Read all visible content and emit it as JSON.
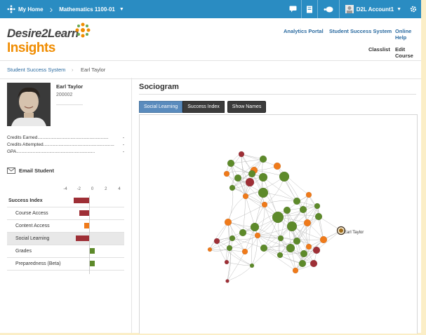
{
  "topbar": {
    "home_label": "My Home",
    "course_label": "Mathematics 1100-01",
    "account_label": "D2L Account1"
  },
  "header": {
    "logo_line1": "Desire2Learn",
    "logo_line2": "Insights",
    "links": [
      "Analytics Portal",
      "Student Success System",
      "Online Help"
    ],
    "sublinks": [
      "Classlist",
      "Edit Course"
    ]
  },
  "breadcrumb": {
    "root": "Student Success System",
    "current": "Earl Taylor"
  },
  "student": {
    "name": "Earl Taylor",
    "id": "200002",
    "stats": [
      {
        "label": "Credits Earned",
        "value": "-"
      },
      {
        "label": "Credits Attempted",
        "value": "-"
      },
      {
        "label": "GPA",
        "value": "-"
      }
    ],
    "email_label": "Email Student"
  },
  "success_index": {
    "axis_ticks": [
      "-4",
      "-2",
      "0",
      "2",
      "4"
    ],
    "axis_min": -4,
    "axis_max": 4,
    "rows": [
      {
        "label": "Success Index",
        "value": -2.3,
        "color": "#9e2f36",
        "bold": true
      },
      {
        "label": "Course Access",
        "value": -1.5,
        "color": "#9e2f36"
      },
      {
        "label": "Content Access",
        "value": -0.7,
        "color": "#ef7a1a"
      },
      {
        "label": "Social Learning",
        "value": -2.0,
        "color": "#9e2f36",
        "highlight": true
      },
      {
        "label": "Grades",
        "value": 0.8,
        "color": "#5d8a2a"
      },
      {
        "label": "Preparedness (Beta)",
        "value": 0.8,
        "color": "#5d8a2a"
      }
    ]
  },
  "sociogram": {
    "title": "Sociogram",
    "tabs": [
      "Social Learning",
      "Success Index",
      "Show Names"
    ],
    "node_label": "Earl Taylor"
  },
  "colors": {
    "topbar": "#2a8cc2",
    "green": "#5d8a2a",
    "orange": "#ef7a1a",
    "red": "#9e2f36"
  }
}
